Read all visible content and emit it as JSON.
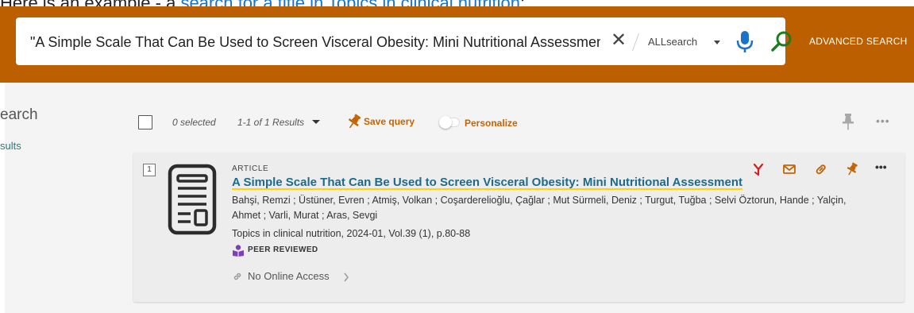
{
  "intro": {
    "prefix": "Here is an example - a ",
    "link_text": "search for a title in Topics in clinical nutrition",
    "suffix": ":"
  },
  "header": {
    "background": "#bb5f00",
    "search_value": "\"A Simple Scale That Can Be Used to Screen Visceral Obesity: Mini Nutritional Assessment\"",
    "clear_icon": "close-icon",
    "scope_label": "ALLsearch",
    "mic_icon": "microphone-icon",
    "search_icon": "magnifier-icon",
    "advanced_search_label": "ADVANCED SEARCH"
  },
  "sidebar": {
    "title": "earch",
    "link": "sults"
  },
  "toolbar": {
    "selected_count": "0 selected",
    "results_range": "1-1 of 1 Results",
    "save_query_label": "Save query",
    "personalize_label": "Personalize",
    "personalize_on": false,
    "accent": "#c46400"
  },
  "results": [
    {
      "rank": "1",
      "type": "ARTICLE",
      "title": "A Simple Scale That Can Be Used to Screen Visceral Obesity: Mini Nutritional Assessment",
      "authors": "Bahşi, Remzi ; Üstüner, Evren ; Atmiş, Volkan ; Coşarderelioğlu, Çağlar ; Mut Sürmeli, Deniz ; Turgut, Tuğba ; Selvi Öztorun, Hande ; Yalçin, Ahmet ; Varli, Murat ; Aras, Sevgi",
      "source": "Topics in clinical nutrition, 2024-01, Vol.39 (1), p.80-88",
      "peer_reviewed_label": "PEER REVIEWED",
      "access_label": "No Online Access",
      "actions": [
        "citation-icon",
        "email-icon",
        "permalink-icon",
        "pin-icon",
        "more-icon"
      ]
    }
  ]
}
